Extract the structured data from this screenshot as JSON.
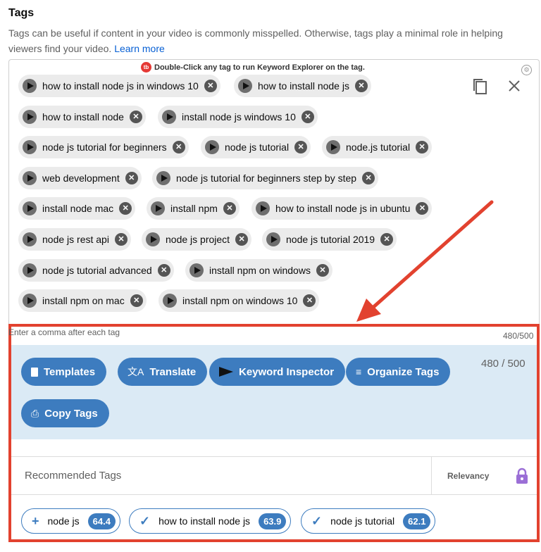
{
  "section": {
    "title": "Tags",
    "description": "Tags can be useful if content in your video is commonly misspelled. Otherwise, tags play a minimal role in helping viewers find your video.",
    "learn_more": "Learn more"
  },
  "tubebuddy": {
    "logo_text": "tb",
    "notice": "Double-Click any tag to run Keyword Explorer on the tag."
  },
  "tags": [
    "how to install node js in windows 10",
    "how to install node js",
    "how to install node",
    "install node js windows 10",
    "node js tutorial for beginners",
    "node js tutorial",
    "node.js tutorial",
    "web development",
    "node js tutorial for beginners step by step",
    "install node mac",
    "install npm",
    "how to install node js in ubuntu",
    "node js rest api",
    "node js project",
    "node js tutorial 2019",
    "node js tutorial advanced",
    "install npm on windows",
    "install npm on mac",
    "install npm on windows 10"
  ],
  "hint": "Enter a comma after each tag",
  "char_count_small": "480/500",
  "char_count": "480 / 500",
  "toolbar": {
    "templates": "Templates",
    "translate": "Translate",
    "keyword_inspector": "Keyword Inspector",
    "organize_tags": "Organize Tags",
    "copy_tags": "Copy Tags"
  },
  "recommended": {
    "title": "Recommended Tags",
    "sort_label": "Relevancy",
    "items": [
      {
        "symbol": "+",
        "label": "node js",
        "score": "64.4"
      },
      {
        "symbol": "✓",
        "label": "how to install node js",
        "score": "63.9"
      },
      {
        "symbol": "✓",
        "label": "node js tutorial",
        "score": "62.1"
      }
    ]
  },
  "colors": {
    "accent": "#3d7cbf",
    "highlight": "#e2422f",
    "panel": "#dbeaf5",
    "chip": "#ebebeb",
    "lock": "#9b6fd6"
  }
}
